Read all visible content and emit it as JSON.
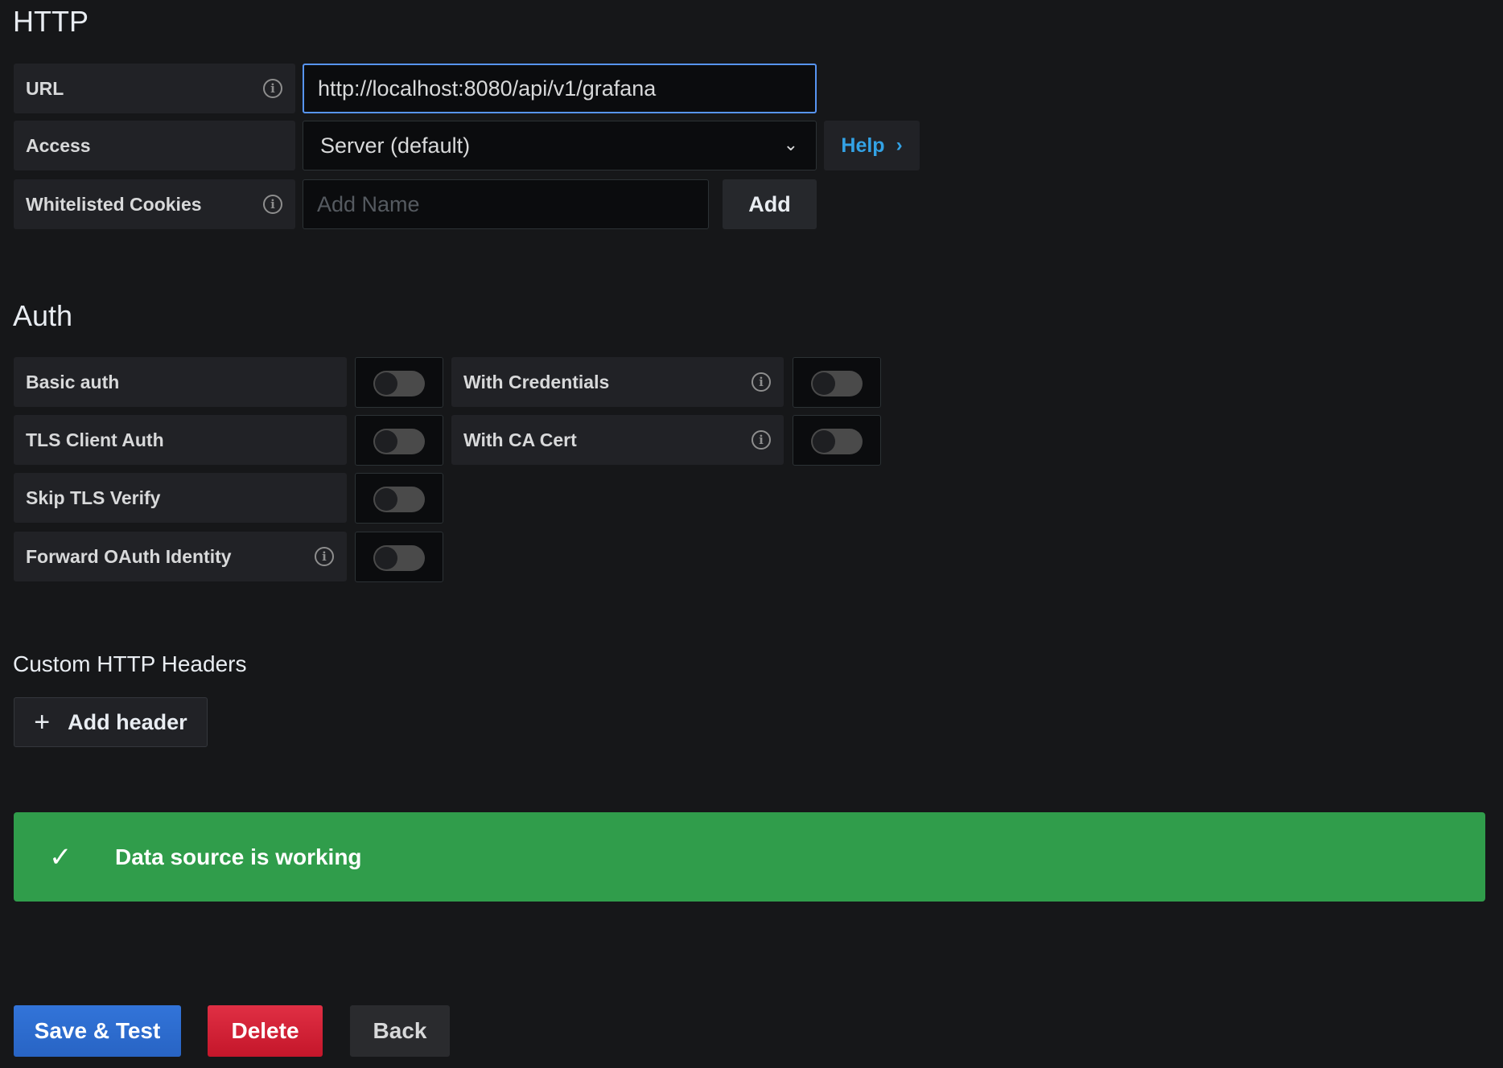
{
  "http": {
    "title": "HTTP",
    "url_label": "URL",
    "url_value": "http://localhost:8080/api/v1/grafana",
    "access_label": "Access",
    "access_value": "Server (default)",
    "help_label": "Help",
    "cookies_label": "Whitelisted Cookies",
    "cookies_placeholder": "Add Name",
    "add_label": "Add"
  },
  "auth": {
    "title": "Auth",
    "toggles": [
      {
        "label": "Basic auth",
        "on": false
      },
      {
        "label": "With Credentials",
        "on": false
      },
      {
        "label": "TLS Client Auth",
        "on": false
      },
      {
        "label": "With CA Cert",
        "on": false
      },
      {
        "label": "Skip TLS Verify",
        "on": false
      },
      {
        "label": "Forward OAuth Identity",
        "on": false
      }
    ]
  },
  "headers": {
    "title": "Custom HTTP Headers",
    "add_label": "Add header"
  },
  "status": {
    "message": "Data source is working",
    "color": "#309d4b"
  },
  "actions": {
    "save": "Save & Test",
    "delete": "Delete",
    "back": "Back"
  }
}
